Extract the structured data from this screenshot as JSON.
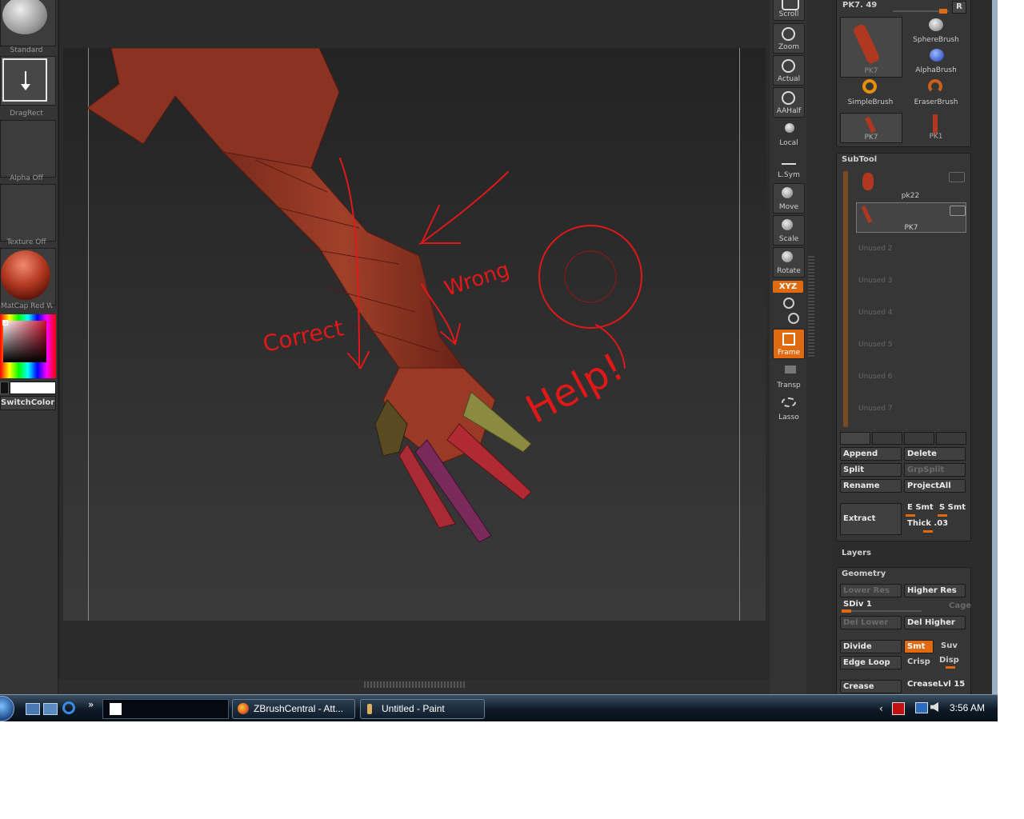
{
  "left_palette": {
    "brush_label": "Standard",
    "stroke_label": "DragRect",
    "alpha_label": "Alpha Off",
    "texture_label": "Texture Off",
    "material_label": "MatCap Red Wa",
    "switch_color_label": "SwitchColor"
  },
  "shelf": {
    "scroll": "Scroll",
    "zoom": "Zoom",
    "actual": "Actual",
    "aahalf": "AAHalf",
    "local": "Local",
    "lsym": "L.Sym",
    "move": "Move",
    "scale": "Scale",
    "rotate": "Rotate",
    "xyz": "XYZ",
    "frame": "Frame",
    "transp": "Transp",
    "lasso": "Lasso"
  },
  "annotations": {
    "correct": "Correct",
    "wrong": "Wrong",
    "help": "Help!"
  },
  "tool": {
    "current": "PK7. 49",
    "r_button": "R",
    "items": [
      "PK7",
      "SphereBrush",
      "AlphaBrush",
      "SimpleBrush",
      "EraserBrush",
      "PK7",
      "PK1"
    ]
  },
  "subtool": {
    "title": "SubTool",
    "items": [
      "pk22",
      "PK7"
    ],
    "unused": [
      "Unused 2",
      "Unused 3",
      "Unused 4",
      "Unused 5",
      "Unused 6",
      "Unused 7"
    ],
    "append": "Append",
    "delete": "Delete",
    "split": "Split",
    "grpsplit": "GrpSplit",
    "rename": "Rename",
    "projectall": "ProjectAll",
    "extract": "Extract",
    "esmt": "E Smt",
    "ssmt": "S Smt",
    "thick": "Thick .03"
  },
  "layers": {
    "title": "Layers"
  },
  "geometry": {
    "title": "Geometry",
    "lower_res": "Lower Res",
    "higher_res": "Higher Res",
    "sdiv": "SDiv 1",
    "cage": "Cage",
    "del_lower": "Del Lower",
    "del_higher": "Del Higher",
    "divide": "Divide",
    "smt": "Smt",
    "suv": "Suv",
    "edge_loop": "Edge Loop",
    "crisp": "Crisp",
    "disp": "Disp",
    "crease": "Crease",
    "crease_lvl": "CreaseLvl 15"
  },
  "taskbar": {
    "window1": "ZBrushCentral - Att...",
    "window2": "Untitled - Paint",
    "clock": "3:56 AM"
  }
}
